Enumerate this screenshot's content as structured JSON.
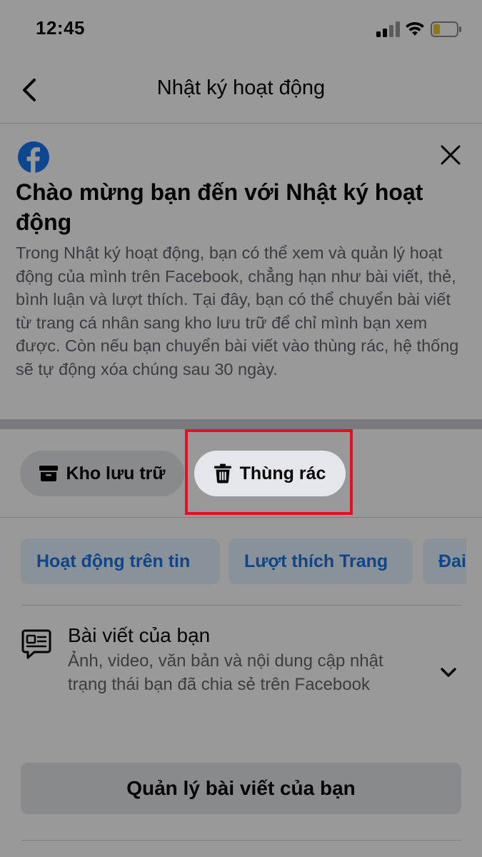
{
  "status_bar": {
    "time": "12:45"
  },
  "header": {
    "title": "Nhật ký hoạt động",
    "back_icon": "chevron-left-icon"
  },
  "banner": {
    "logo_icon": "facebook-logo",
    "close_icon": "close-icon",
    "title": "Chào mừng bạn đến với Nhật ký hoạt động",
    "body": "Trong Nhật ký hoạt động, bạn có thể xem và quản lý hoạt động của mình trên Facebook, chẳng hạn như bài viết, thẻ, bình luận và lượt thích. Tại đây, bạn có thể chuyển bài viết từ trang cá nhân sang kho lưu trữ để chỉ mình bạn xem được. Còn nếu bạn chuyển bài viết vào thùng rác, hệ thống sẽ tự động xóa chúng sau 30 ngày."
  },
  "actions": {
    "archive_label": "Kho lưu trữ",
    "trash_label": "Thùng rác"
  },
  "filters": {
    "chips": [
      "Hoạt động trên tin",
      "Lượt thích Trang",
      "Đai"
    ]
  },
  "your_posts": {
    "title": "Bài viết của bạn",
    "description": "Ảnh, video, văn bản và nội dung cập nhật trạng thái bạn đã chia sẻ trên Facebook",
    "manage_button": "Quản lý bài viết của bạn"
  },
  "colors": {
    "accent": "#1b74e4",
    "highlight_box": "#e3111b",
    "facebook_blue": "#1877f2"
  }
}
